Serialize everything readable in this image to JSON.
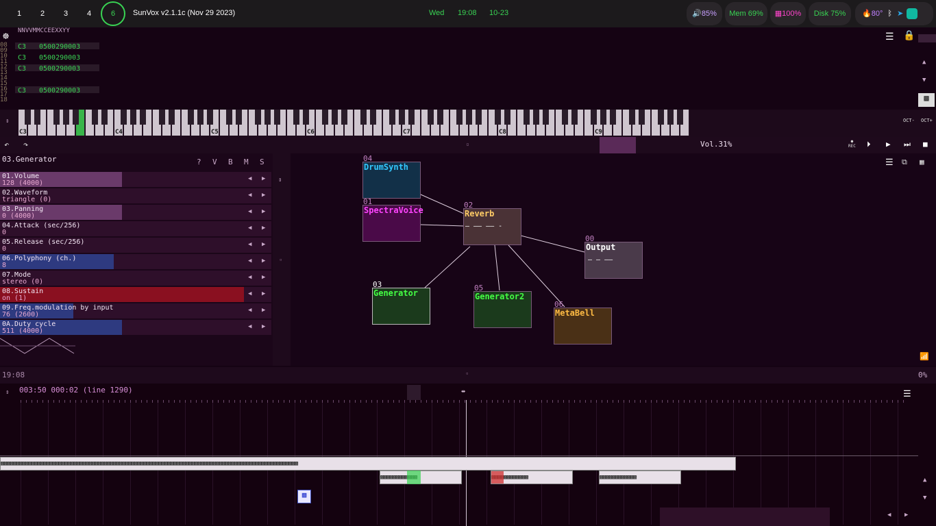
{
  "topbar": {
    "workspaces": [
      "1",
      "2",
      "3",
      "4",
      "6"
    ],
    "active_workspace": "6",
    "app_title": "SunVox v2.1.1c (Nov 29 2023)",
    "day": "Wed",
    "time": "19:08",
    "date": "10-23",
    "volume": "85%",
    "mem": "Mem 69%",
    "cpu": "100%",
    "disk": "Disk 75%",
    "temp": "80°"
  },
  "pattern": {
    "header": "NNVVMMCCEEXXYY",
    "rows": [
      {
        "num": "09",
        "note": "C3",
        "data": "0500290003"
      },
      {
        "num": "10",
        "note": "C3",
        "data": "0500290003"
      },
      {
        "num": "12",
        "note": "C3",
        "data": "0500290003"
      },
      {
        "num": "16",
        "note": "C3",
        "data": "0500290003"
      }
    ]
  },
  "piano": {
    "octaves": [
      "C3",
      "C4",
      "C5",
      "C6",
      "C7",
      "C8",
      "C9"
    ],
    "oct_minus": "OCT-",
    "oct_plus": "OCT+"
  },
  "transport": {
    "volume": "Vol.31%",
    "rec": "REC"
  },
  "props": {
    "module_title": "03.Generator",
    "buttons": [
      "?",
      "V",
      "B",
      "M",
      "S"
    ],
    "controllers": [
      {
        "name": "01.Volume",
        "value": "128 (4000)",
        "fill": 0.45,
        "color": "#6a3a6a"
      },
      {
        "name": "02.Waveform",
        "value": "triangle (0)",
        "fill": 0,
        "color": "#3a1a36"
      },
      {
        "name": "03.Panning",
        "value": "0 (4000)",
        "fill": 0.45,
        "color": "#6a3a6a"
      },
      {
        "name": "04.Attack (sec/256)",
        "value": "0",
        "fill": 0,
        "color": "#4a1030"
      },
      {
        "name": "05.Release (sec/256)",
        "value": "0",
        "fill": 0,
        "color": "#4a1030"
      },
      {
        "name": "06.Polyphony (ch.)",
        "value": "8",
        "fill": 0.42,
        "color": "#2e3a80"
      },
      {
        "name": "07.Mode",
        "value": "stereo (0)",
        "fill": 0,
        "color": "#3a1a36"
      },
      {
        "name": "08.Sustain",
        "value": "on (1)",
        "fill": 0.9,
        "color": "#8a1020"
      },
      {
        "name": "09.Freq.modulation by input",
        "value": "76 (2600)",
        "fill": 0.27,
        "color": "#2e3a80"
      },
      {
        "name": "0A.Duty cycle",
        "value": "511 (4000)",
        "fill": 0.45,
        "color": "#2e3a80"
      }
    ]
  },
  "modules": [
    {
      "num": "04",
      "name": "DrumSynth",
      "bg": "#123048",
      "fg": "#33c8ff"
    },
    {
      "num": "01",
      "name": "SpectraVoice",
      "bg": "#4a0a48",
      "fg": "#ff44ff"
    },
    {
      "num": "02",
      "name": "Reverb",
      "bg": "#4a3236",
      "fg": "#ffcc66"
    },
    {
      "num": "00",
      "name": "Output",
      "bg": "#4a3a4a",
      "fg": "#ffffff"
    },
    {
      "num": "03",
      "name": "Generator",
      "bg": "#1b3a1c",
      "fg": "#44ff44"
    },
    {
      "num": "05",
      "name": "Generator2",
      "bg": "#1b3a1c",
      "fg": "#44ff44"
    },
    {
      "num": "06",
      "name": "MetaBell",
      "bg": "#4a3016",
      "fg": "#ffbb44"
    }
  ],
  "timeline": {
    "clock": "19:08",
    "percent": "0%",
    "position": "003:50 000:02 (line 1290)"
  }
}
